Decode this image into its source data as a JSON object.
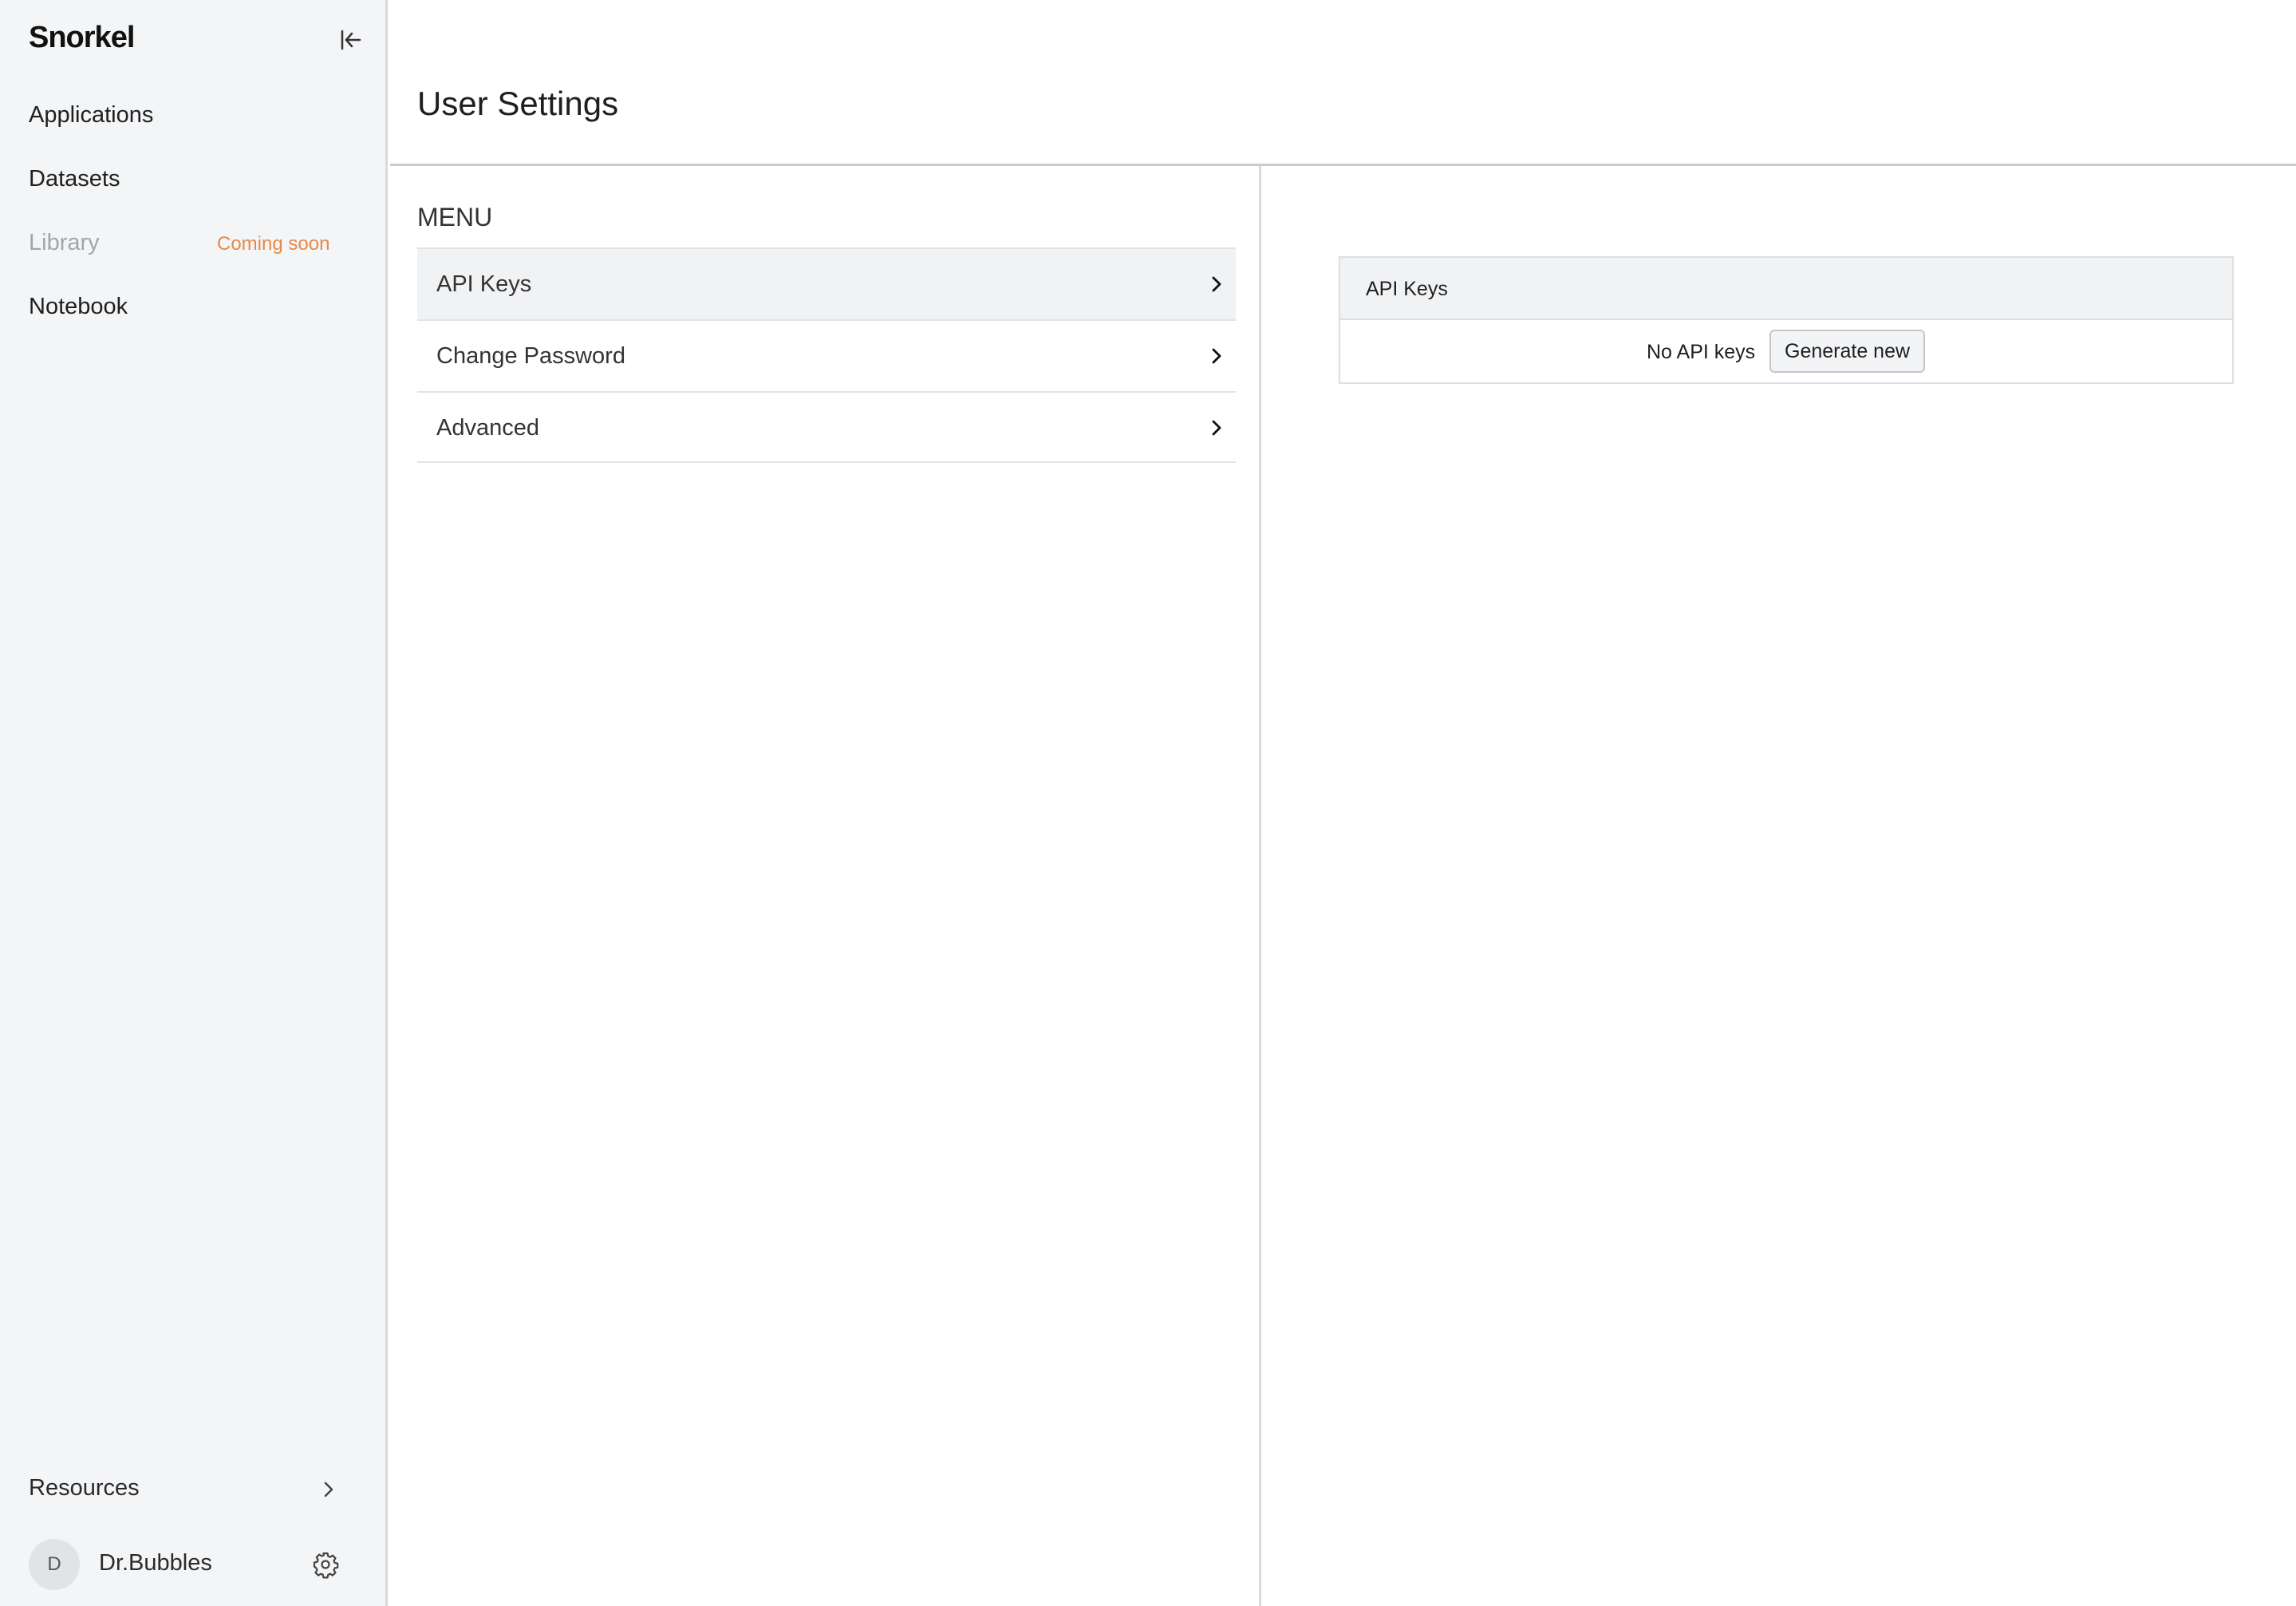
{
  "sidebar": {
    "logo": "Snorkel",
    "nav": {
      "applications": "Applications",
      "datasets": "Datasets",
      "library": "Library",
      "library_badge": "Coming soon",
      "notebook": "Notebook"
    },
    "resources_label": "Resources",
    "user": {
      "initial": "D",
      "name": "Dr.Bubbles"
    }
  },
  "header": {
    "title": "User Settings"
  },
  "menu": {
    "heading": "MENU",
    "items": [
      {
        "label": "API Keys",
        "active": true
      },
      {
        "label": "Change Password",
        "active": false
      },
      {
        "label": "Advanced",
        "active": false
      }
    ]
  },
  "api_keys": {
    "title": "API Keys",
    "empty_text": "No API keys",
    "generate_label": "Generate new"
  },
  "colors": {
    "sidebar_bg": "#f4f5f7",
    "coming_soon": "#e8894a",
    "active_row": "#f1f2f4"
  }
}
